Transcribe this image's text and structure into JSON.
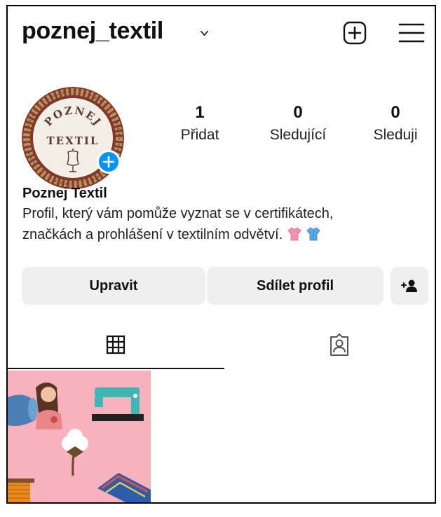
{
  "header": {
    "username": "poznej_textil",
    "icons": [
      "chevron-down-icon",
      "add-post-icon",
      "menu-icon"
    ]
  },
  "avatar": {
    "logo_text_top": "POZNEJ",
    "logo_text_middle": "TEXTIL"
  },
  "stats": [
    {
      "value": "1",
      "label": "Přidat"
    },
    {
      "value": "0",
      "label": "Sledující"
    },
    {
      "value": "0",
      "label": "Sleduji"
    }
  ],
  "bio": {
    "name": "Poznej Textil",
    "line1": "Profil, který vám pomůže vyznat se v certifikátech,",
    "line2": "značkách a prohlášení v textilním odvětví."
  },
  "buttons": {
    "edit": "Upravit",
    "share": "Sdílet profil"
  },
  "tabs": {
    "active": "grid",
    "items": [
      "grid-icon",
      "tagged-icon"
    ]
  },
  "colors": {
    "accent_blue": "#0095f6",
    "button_bg": "#efefef",
    "post_bg": "#f7b2bd"
  }
}
